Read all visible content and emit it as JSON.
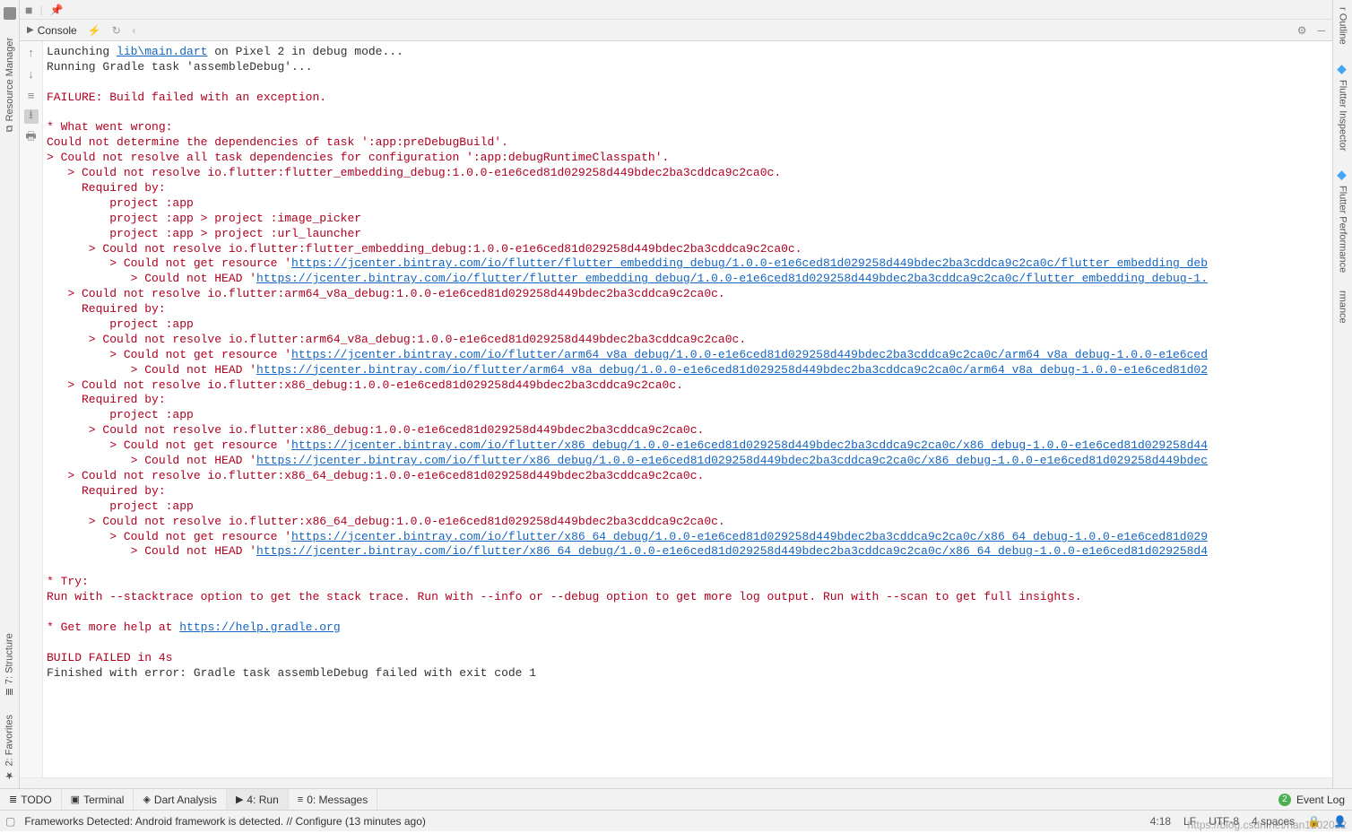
{
  "left_sidebar": {
    "resource_manager": "Resource Manager",
    "structure": "7: Structure",
    "favorites": "2: Favorites"
  },
  "right_sidebar": {
    "outline": "r Outline",
    "flutter_inspector": "Flutter Inspector",
    "flutter_performance": "Flutter Performance",
    "rmance": "rmance"
  },
  "tool_header": {
    "console_label": "Console"
  },
  "console": {
    "line1_prefix": "Launching ",
    "line1_link": "lib\\main.dart",
    "line1_suffix": " on Pixel 2 in debug mode...",
    "line2": "Running Gradle task 'assembleDebug'...",
    "failure": "FAILURE: Build failed with an exception.",
    "what_wrong": "* What went wrong:",
    "err_root": "Could not determine the dependencies of task ':app:preDebugBuild'.",
    "err_l1": "> Could not resolve all task dependencies for configuration ':app:debugRuntimeClasspath'.",
    "err_l2": "   > Could not resolve io.flutter:flutter_embedding_debug:1.0.0-e1e6ced81d029258d449bdec2ba3cddca9c2ca0c.",
    "req_by": "     Required by:",
    "proj_app": "         project :app",
    "proj_app_ip": "         project :app > project :image_picker",
    "proj_app_ul": "         project :app > project :url_launcher",
    "err_inner1": "      > Could not resolve io.flutter:flutter_embedding_debug:1.0.0-e1e6ced81d029258d449bdec2ba3cddca9c2ca0c.",
    "err_res1_pre": "         > Could not get resource '",
    "err_res1_link": "https://jcenter.bintray.com/io/flutter/flutter_embedding_debug/1.0.0-e1e6ced81d029258d449bdec2ba3cddca9c2ca0c/flutter_embedding_deb",
    "err_head1_pre": "            > Could not HEAD '",
    "err_head1_link": "https://jcenter.bintray.com/io/flutter/flutter_embedding_debug/1.0.0-e1e6ced81d029258d449bdec2ba3cddca9c2ca0c/flutter_embedding_debug-1.",
    "arm_header": "   > Could not resolve io.flutter:arm64_v8a_debug:1.0.0-e1e6ced81d029258d449bdec2ba3cddca9c2ca0c.",
    "arm_inner": "      > Could not resolve io.flutter:arm64_v8a_debug:1.0.0-e1e6ced81d029258d449bdec2ba3cddca9c2ca0c.",
    "arm_res_pre": "         > Could not get resource '",
    "arm_res_link": "https://jcenter.bintray.com/io/flutter/arm64_v8a_debug/1.0.0-e1e6ced81d029258d449bdec2ba3cddca9c2ca0c/arm64_v8a_debug-1.0.0-e1e6ced",
    "arm_head_pre": "            > Could not HEAD '",
    "arm_head_link": "https://jcenter.bintray.com/io/flutter/arm64_v8a_debug/1.0.0-e1e6ced81d029258d449bdec2ba3cddca9c2ca0c/arm64_v8a_debug-1.0.0-e1e6ced81d02",
    "x86_header": "   > Could not resolve io.flutter:x86_debug:1.0.0-e1e6ced81d029258d449bdec2ba3cddca9c2ca0c.",
    "x86_inner": "      > Could not resolve io.flutter:x86_debug:1.0.0-e1e6ced81d029258d449bdec2ba3cddca9c2ca0c.",
    "x86_res_pre": "         > Could not get resource '",
    "x86_res_link": "https://jcenter.bintray.com/io/flutter/x86_debug/1.0.0-e1e6ced81d029258d449bdec2ba3cddca9c2ca0c/x86_debug-1.0.0-e1e6ced81d029258d44",
    "x86_head_pre": "            > Could not HEAD '",
    "x86_head_link": "https://jcenter.bintray.com/io/flutter/x86_debug/1.0.0-e1e6ced81d029258d449bdec2ba3cddca9c2ca0c/x86_debug-1.0.0-e1e6ced81d029258d449bdec",
    "x8664_header": "   > Could not resolve io.flutter:x86_64_debug:1.0.0-e1e6ced81d029258d449bdec2ba3cddca9c2ca0c.",
    "x8664_inner": "      > Could not resolve io.flutter:x86_64_debug:1.0.0-e1e6ced81d029258d449bdec2ba3cddca9c2ca0c.",
    "x8664_res_pre": "         > Could not get resource '",
    "x8664_res_link": "https://jcenter.bintray.com/io/flutter/x86_64_debug/1.0.0-e1e6ced81d029258d449bdec2ba3cddca9c2ca0c/x86_64_debug-1.0.0-e1e6ced81d029",
    "x8664_head_pre": "            > Could not HEAD '",
    "x8664_head_link": "https://jcenter.bintray.com/io/flutter/x86_64_debug/1.0.0-e1e6ced81d029258d449bdec2ba3cddca9c2ca0c/x86_64_debug-1.0.0-e1e6ced81d029258d4",
    "try_header": "* Try:",
    "try_body": "Run with --stacktrace option to get the stack trace. Run with --info or --debug option to get more log output. Run with --scan to get full insights.",
    "help_pre": "* Get more help at ",
    "help_link": "https://help.gradle.org",
    "build_failed": "BUILD FAILED in 4s",
    "finished": "Finished with error: Gradle task assembleDebug failed with exit code 1"
  },
  "bottom_tabs": {
    "todo": "TODO",
    "terminal": "Terminal",
    "dart_analysis": "Dart Analysis",
    "run": "4: Run",
    "messages": "0: Messages",
    "event_log": "Event Log",
    "event_badge": "2"
  },
  "status_bar": {
    "msg": "Frameworks Detected: Android framework is detected. // Configure (13 minutes ago)",
    "pos": "4:18",
    "lf": "LF",
    "enc": "UTF-8",
    "spaces": "4 spaces"
  },
  "watermark": "https://blog.csdn.net/han1202012"
}
